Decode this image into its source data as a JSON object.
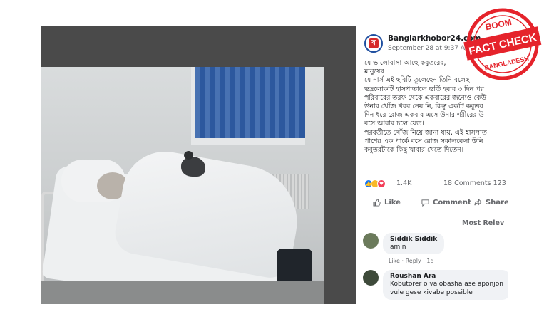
{
  "post": {
    "page_name": "Banglarkhobor24.com",
    "time": "September 28 at 9:37 AM ·",
    "text_lines": [
      "যে ভালোবাসা আছে কবুতরের,",
      "মানুষের",
      "যে নার্স এই ছবিটি তুলেছেন তিনি বলেছ",
      "ভদ্রলোকটি হাসপাতালে ভর্তি হবার ৩ দিন পর",
      "পরিবারের তরফ থেকে একবারের জন্যেও কেউ",
      "উনার খোঁজ খবর নেয় নি, কিন্তু একটি কবুতর",
      "দিন ধরে রোজ একবার এসে উনার শরীরের উ",
      "বসে আবার চলে যেত।",
      "পরবর্তীতে খোঁজ নিয়ে জানা যায়, এই হাসপাত",
      "পাশের এক পার্কে বসে রোজ সকালবেলা উনি",
      "কবুতরটাকে কিছু খাবার খেতে দিতেন।"
    ],
    "reaction_count": "1.4K",
    "comment_count": "18 Comments  123",
    "actions": {
      "like": "Like",
      "comment": "Comment",
      "share": "Share"
    },
    "sort_label": "Most Relev"
  },
  "comments": [
    {
      "name": "Siddik Siddik",
      "text": "amin",
      "meta": "Like · Reply · 1d"
    },
    {
      "name": "Roushan Ara",
      "text_lines": [
        "Kobutorer o valobasha ase aponjon",
        "vule gese kivabe possible"
      ]
    }
  ],
  "stamp": {
    "top": "BOOM",
    "main": "FACT CHECK",
    "bottom": "BANGLADESH"
  },
  "colors": {
    "stamp_red": "#e5232b",
    "link_blue": "#1877f2"
  }
}
